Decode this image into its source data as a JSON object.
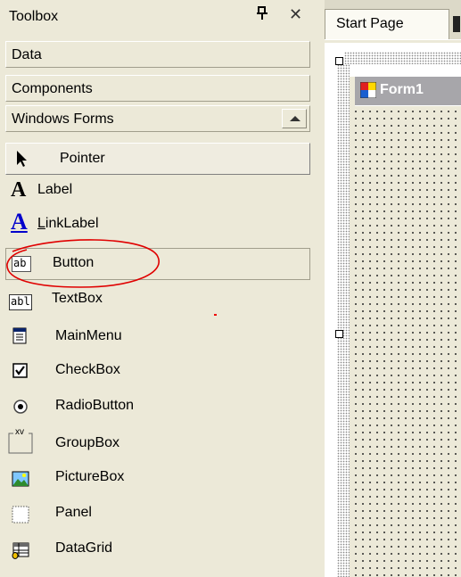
{
  "toolbox": {
    "title": "Toolbox",
    "pin_glyph": " ⊥",
    "close_glyph": "✕",
    "sections": {
      "data": "Data",
      "components": "Components",
      "windows_forms": "Windows Forms"
    },
    "items": [
      {
        "label": "Pointer",
        "icon": "pointer-icon"
      },
      {
        "label": "Label",
        "icon": "label-icon"
      },
      {
        "label": "LinkLabel",
        "icon": "linklabel-icon"
      },
      {
        "label": "Button",
        "icon": "button-icon"
      },
      {
        "label": "TextBox",
        "icon": "textbox-icon"
      },
      {
        "label": "MainMenu",
        "icon": "mainmenu-icon"
      },
      {
        "label": "CheckBox",
        "icon": "checkbox-icon"
      },
      {
        "label": "RadioButton",
        "icon": "radiobutton-icon"
      },
      {
        "label": "GroupBox",
        "icon": "groupbox-icon"
      },
      {
        "label": "PictureBox",
        "icon": "picturebox-icon"
      },
      {
        "label": "Panel",
        "icon": "panel-icon"
      },
      {
        "label": "DataGrid",
        "icon": "datagrid-icon"
      }
    ],
    "icon_text": {
      "label": "A",
      "linklabel": "A",
      "button": "ab",
      "textbox": "abl",
      "groupbox": "xv"
    }
  },
  "designer": {
    "tab_label": "Start Page",
    "form_title": "Form1"
  },
  "colors": {
    "highlight_ellipse": "#e00000",
    "form_title_bg": "#a7a6aa",
    "link_blue": "#0000cc"
  }
}
